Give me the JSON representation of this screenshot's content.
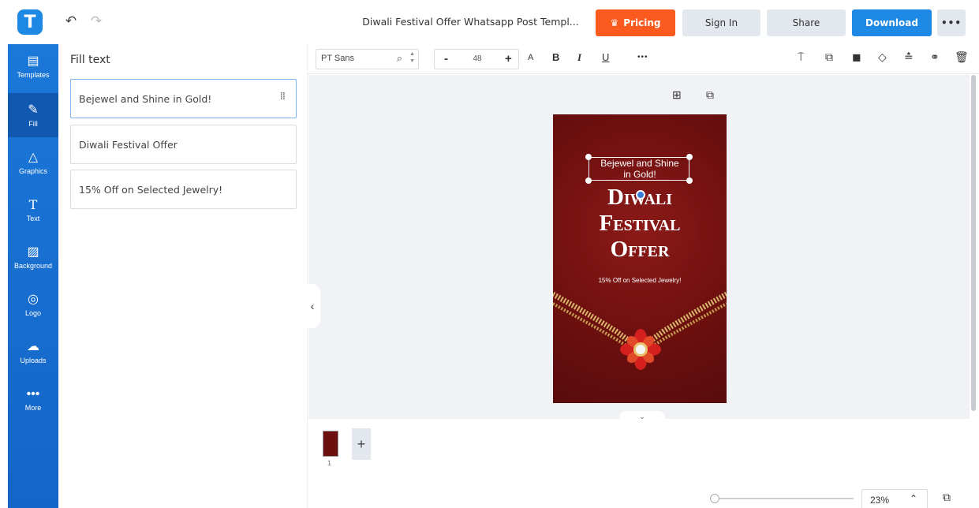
{
  "app": {
    "logo_letter": "T",
    "document_title": "Diwali Festival Offer Whatsapp Post Templ...",
    "pricing_label": "Pricing",
    "signin_label": "Sign In",
    "share_label": "Share",
    "download_label": "Download",
    "more_label": "•••",
    "accent_color": "#1e88e5",
    "pricing_color": "#fa5a1e"
  },
  "sidebar": {
    "items": [
      {
        "label": "Templates",
        "icon": "templates-icon"
      },
      {
        "label": "Fill",
        "icon": "pencil-icon",
        "active": true
      },
      {
        "label": "Graphics",
        "icon": "shapes-icon"
      },
      {
        "label": "Text",
        "icon": "text-icon"
      },
      {
        "label": "Background",
        "icon": "background-icon"
      },
      {
        "label": "Logo",
        "icon": "logo-icon"
      },
      {
        "label": "Uploads",
        "icon": "cloud-upload-icon"
      },
      {
        "label": "More",
        "icon": "more-icon"
      }
    ]
  },
  "panel": {
    "title": "Fill text",
    "fields": [
      {
        "value": "Bejewel and Shine in Gold!"
      },
      {
        "value": "Diwali Festival Offer"
      },
      {
        "value": "15% Off on Selected Jewelry!"
      }
    ]
  },
  "toolbar": {
    "font_family": "PT Sans",
    "font_size": "48",
    "minus": "-",
    "plus": "+"
  },
  "poster": {
    "tagline_line1": "Bejewel and Shine",
    "tagline_line2": "in Gold!",
    "title_line1": "Diwali",
    "title_line2": "Festival",
    "title_line3": "Offer",
    "offer": "15% Off on Selected Jewelry!",
    "background_color": "#6b0f0f"
  },
  "pages": {
    "current": "1"
  },
  "zoom": {
    "level": "23%",
    "fraction": 0.0
  }
}
